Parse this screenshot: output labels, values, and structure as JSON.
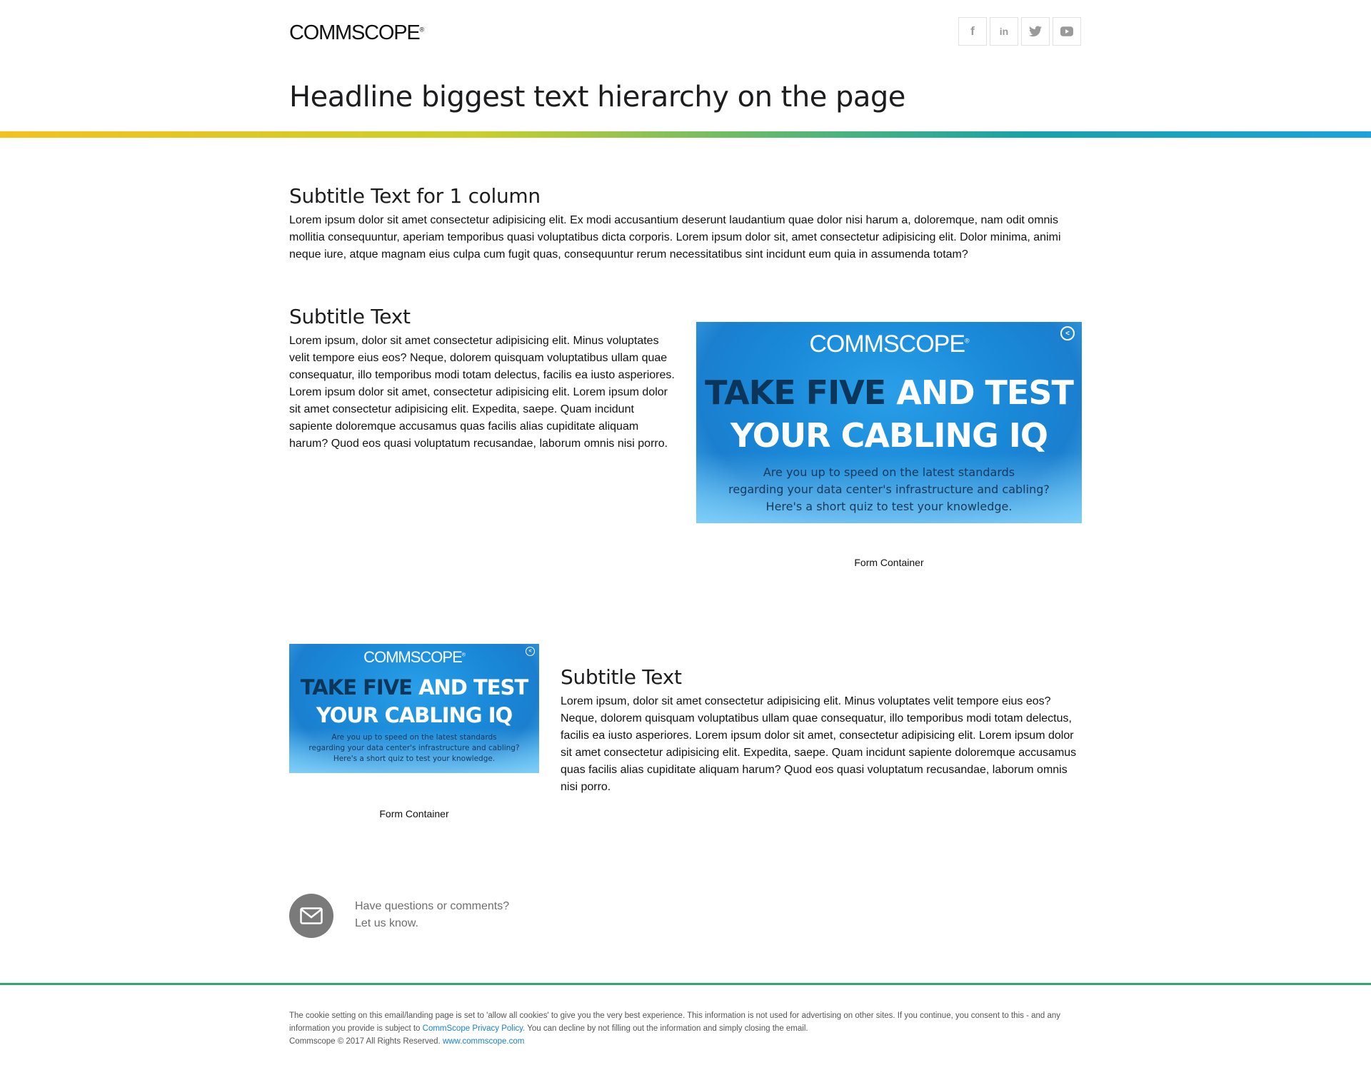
{
  "header": {
    "logo_text": "COMMSCOPE",
    "logo_mark": "®",
    "social": [
      {
        "icon": "facebook-icon",
        "glyph": "f"
      },
      {
        "icon": "linkedin-icon",
        "glyph": "in"
      },
      {
        "icon": "twitter-icon",
        "glyph": "🐦"
      },
      {
        "icon": "youtube-icon",
        "glyph": "▶"
      }
    ],
    "headline": "Headline biggest text hierarchy on the page"
  },
  "section1": {
    "subtitle": "Subtitle Text for 1 column",
    "body": "Lorem ipsum dolor sit amet consectetur adipisicing elit. Ex modi accusantium deserunt laudantium quae dolor nisi harum a, doloremque, nam odit omnis mollitia consequuntur, aperiam temporibus quasi voluptatibus dicta corporis. Lorem ipsum dolor sit, amet consectetur adipisicing elit. Dolor minima, animi neque iure, atque magnam eius culpa cum fugit quas, consequuntur rerum necessitatibus sint incidunt eum quia in assumenda totam?"
  },
  "section2": {
    "subtitle": "Subtitle Text",
    "body": "Lorem ipsum, dolor sit amet consectetur adipisicing elit. Minus voluptates velit tempore eius eos? Neque, dolorem quisquam voluptatibus ullam quae consequatur, illo temporibus modi totam delectus, facilis ea iusto asperiores. Lorem ipsum dolor sit amet, consectetur adipisicing elit. Lorem ipsum dolor sit amet consectetur adipisicing elit. Expedita, saepe. Quam incidunt sapiente doloremque accusamus quas facilis alias cupiditate aliquam harum? Quod eos quasi voluptatum recusandae, laborum omnis nisi porro.",
    "form_label": "Form Container"
  },
  "banner": {
    "logo": "COMMSCOPE",
    "logo_mark": "®",
    "head_dark": "TAKE FIVE",
    "head_light_1": " AND TEST",
    "head_light_2": "YOUR CABLING IQ",
    "sub_1": "Are you up to speed on the latest standards",
    "sub_2": "regarding your data center's infrastructure and cabling?",
    "sub_3": "Here's a short quiz to test your knowledge.",
    "share_glyph": "<"
  },
  "section3": {
    "subtitle": "Subtitle Text",
    "body": "Lorem ipsum, dolor sit amet consectetur adipisicing elit. Minus voluptates velit tempore eius eos? Neque, dolorem quisquam voluptatibus ullam quae consequatur, illo temporibus modi totam delectus, facilis ea iusto asperiores. Lorem ipsum dolor sit amet, consectetur adipisicing elit. Lorem ipsum dolor sit amet consectetur adipisicing elit. Expedita, saepe. Quam incidunt sapiente doloremque accusamus quas facilis alias cupiditate aliquam harum? Quod eos quasi voluptatum recusandae, laborum omnis nisi porro.",
    "form_label": "Form Container"
  },
  "contact": {
    "icon": "envelope-icon",
    "line1": "Have questions or comments?",
    "line2": "Let us know."
  },
  "footer": {
    "cookie_pre": "The cookie setting on this email/landing page is set to 'allow all cookies' to give you the very best experience. This information is not used for advertising on other sites. If you continue, you consent to this - and any information you provide is subject to ",
    "privacy_link": "CommScope Privacy Policy.",
    "cookie_post": " You can decline by not filling out the information and simply closing the email.",
    "copyright": "Commscope © 2017 All Rights Reserved. ",
    "site_link": "www.commscope.com"
  },
  "colors": {
    "gradient_start": "#f4c11e",
    "gradient_end": "#1aa3dc",
    "footer_line": "#2ea96b",
    "link": "#1a7fd1",
    "banner_blue": "#1989d8"
  }
}
